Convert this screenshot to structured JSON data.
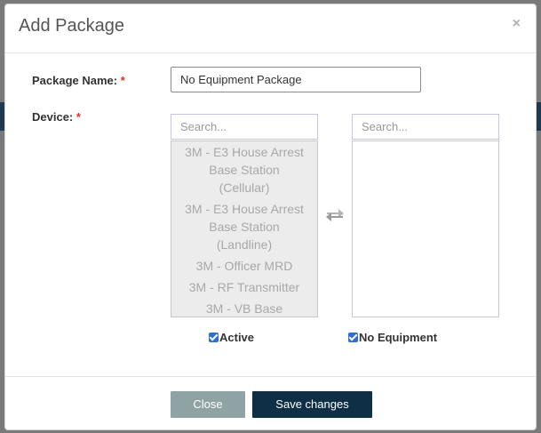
{
  "modal": {
    "title": "Add Package",
    "close_symbol": "×"
  },
  "form": {
    "package_name_label": "Package Name:",
    "package_name_value": "No Equipment Package",
    "device_label": "Device:",
    "required_mark": "*"
  },
  "available_list": {
    "search_placeholder": "Search...",
    "items": [
      "3M - E3 House Arrest Base Station (Cellular)",
      "3M - E3 House Arrest Base Station (Landline)",
      "3M - Officer MRD",
      "3M - RF Transmitter",
      "3M - VB Base"
    ]
  },
  "selected_list": {
    "search_placeholder": "Search...",
    "items": []
  },
  "checkboxes": {
    "active_label": "Active",
    "active_checked": true,
    "no_equipment_label": "No Equipment",
    "no_equipment_checked": true
  },
  "footer": {
    "close_label": "Close",
    "save_label": "Save changes"
  },
  "colors": {
    "save_button": "#0e2f46",
    "close_button": "#8fa3a5",
    "required": "#d9312b",
    "checkbox": "#2f6fd3"
  }
}
